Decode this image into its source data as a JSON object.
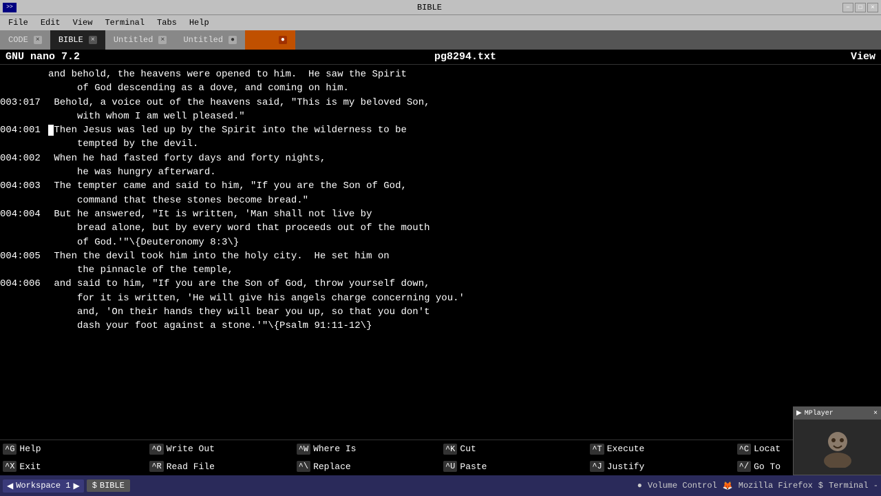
{
  "titlebar": {
    "title": "BIBLE",
    "icon_label": ">>",
    "controls": [
      "−",
      "□",
      "×"
    ]
  },
  "menubar": {
    "items": [
      "File",
      "Edit",
      "View",
      "Terminal",
      "Tabs",
      "Help"
    ]
  },
  "tabs": [
    {
      "label": "CODE",
      "active": false,
      "closable": true
    },
    {
      "label": "BIBLE",
      "active": true,
      "closable": true
    },
    {
      "label": "Untitled",
      "active": false,
      "closable": true
    },
    {
      "label": "Untitled",
      "active": false,
      "closable": true
    },
    {
      "label": "",
      "active": false,
      "closable": true,
      "orange": true
    }
  ],
  "nano": {
    "version_label": "GNU nano 7.2",
    "filename": "pg8294.txt",
    "mode": "View"
  },
  "lines": [
    {
      "num": "",
      "content": "and behold, the heavens were opened to him.  He saw the Spirit"
    },
    {
      "num": "",
      "content": "     of God descending as a dove, and coming on him."
    },
    {
      "num": "003:017",
      "content": " Behold, a voice out of the heavens said, \"This is my beloved Son,"
    },
    {
      "num": "",
      "content": "     with whom I am well pleased.\""
    },
    {
      "num": "004:001",
      "content": " Then Jesus was led up by the Spirit into the wilderness to be",
      "cursor_at": 0
    },
    {
      "num": "",
      "content": "     tempted by the devil."
    },
    {
      "num": "004:002",
      "content": " When he had fasted forty days and forty nights,"
    },
    {
      "num": "",
      "content": "     he was hungry afterward."
    },
    {
      "num": "004:003",
      "content": " The tempter came and said to him, \"If you are the Son of God,"
    },
    {
      "num": "",
      "content": "     command that these stones become bread.\""
    },
    {
      "num": "004:004",
      "content": " But he answered, \"It is written, 'Man shall not live by"
    },
    {
      "num": "",
      "content": "     bread alone, but by every word that proceeds out of the mouth"
    },
    {
      "num": "",
      "content": "     of God.'\"\\{Deuteronomy 8:3\\}"
    },
    {
      "num": "004:005",
      "content": " Then the devil took him into the holy city.  He set him on"
    },
    {
      "num": "",
      "content": "     the pinnacle of the temple,"
    },
    {
      "num": "004:006",
      "content": " and said to him, \"If you are the Son of God, throw yourself down,"
    },
    {
      "num": "",
      "content": "     for it is written, 'He will give his angels charge concerning you.'"
    },
    {
      "num": "",
      "content": "     and, 'On their hands they will bear you up, so that you don't"
    },
    {
      "num": "",
      "content": "     dash your foot against a stone.'\"\\{Psalm 91:11-12\\}"
    }
  ],
  "commands": [
    {
      "key": "^G",
      "label": "Help"
    },
    {
      "key": "^O",
      "label": "Write Out"
    },
    {
      "key": "^W",
      "label": "Where Is"
    },
    {
      "key": "^K",
      "label": "Cut"
    },
    {
      "key": "^T",
      "label": "Execute"
    },
    {
      "key": "^C",
      "label": "Locat"
    },
    {
      "key": "^X",
      "label": "Exit"
    },
    {
      "key": "^R",
      "label": "Read File"
    },
    {
      "key": "^\\",
      "label": "Replace"
    },
    {
      "key": "^U",
      "label": "Paste"
    },
    {
      "key": "^J",
      "label": "Justify"
    },
    {
      "key": "^/",
      "label": "Go To"
    }
  ],
  "taskbar": {
    "workspace_label": "Workspace 1",
    "items": [
      {
        "label": "BIBLE",
        "icon": "terminal"
      },
      {
        "label": "Volume Control"
      },
      {
        "label": "Mozilla Firefox"
      },
      {
        "label": "Terminal"
      }
    ]
  },
  "mplayer": {
    "title": "MPlayer"
  }
}
